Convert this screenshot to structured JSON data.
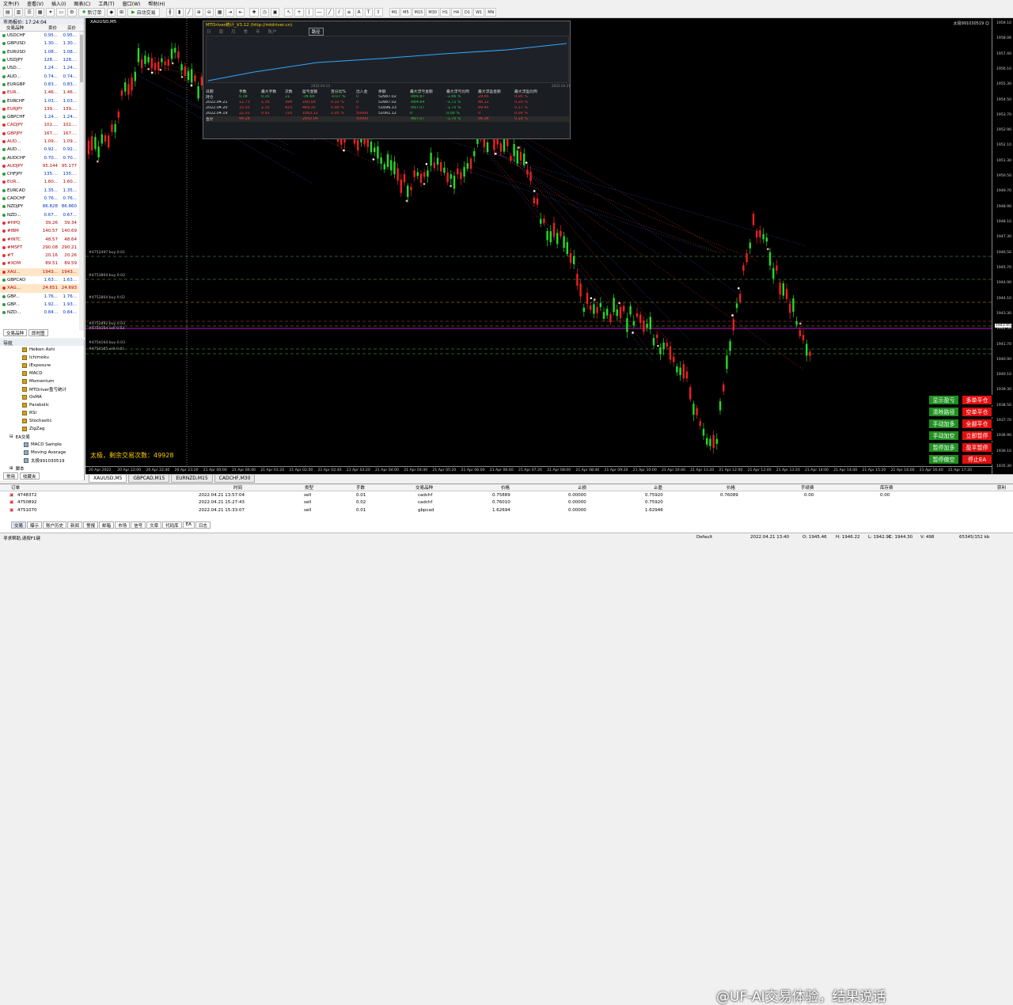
{
  "menu": [
    "文件(F)",
    "查看(V)",
    "插入(I)",
    "图表(C)",
    "工具(T)",
    "窗口(W)",
    "帮助(H)"
  ],
  "toolbar": {
    "new_order": "新订单",
    "auto_trading": "自动交易",
    "timeframes": [
      "M1",
      "M5",
      "M15",
      "M30",
      "H1",
      "H4",
      "D1",
      "W1",
      "MN"
    ]
  },
  "market_watch": {
    "title": "市场报价: 17:24:04",
    "col_symbol": "交易品种",
    "col_bid": "卖价",
    "col_ask": "买价",
    "rows": [
      {
        "sym": "USDCHF",
        "bid": "0.95...",
        "ask": "0.95...",
        "dir": "u"
      },
      {
        "sym": "GBPUSD",
        "bid": "1.30...",
        "ask": "1.30...",
        "dir": "u"
      },
      {
        "sym": "EURUSD",
        "bid": "1.08...",
        "ask": "1.08...",
        "dir": "u"
      },
      {
        "sym": "USDJPY",
        "bid": "128....",
        "ask": "128....",
        "dir": "u"
      },
      {
        "sym": "USD...",
        "bid": "1.24...",
        "ask": "1.24...",
        "dir": "u"
      },
      {
        "sym": "AUD...",
        "bid": "0.74...",
        "ask": "0.74...",
        "dir": "u"
      },
      {
        "sym": "EURGBP",
        "bid": "0.83...",
        "ask": "0.83...",
        "dir": "u"
      },
      {
        "sym": "EUR...",
        "bid": "1.46...",
        "ask": "1.46...",
        "dir": "s"
      },
      {
        "sym": "EURCHF",
        "bid": "1.03...",
        "ask": "1.03...",
        "dir": "u"
      },
      {
        "sym": "EURJPY",
        "bid": "139....",
        "ask": "139....",
        "dir": "s"
      },
      {
        "sym": "GBPCHF",
        "bid": "1.24...",
        "ask": "1.24...",
        "dir": "u"
      },
      {
        "sym": "CADJPY",
        "bid": "102....",
        "ask": "102....",
        "dir": "s"
      },
      {
        "sym": "GBPJPY",
        "bid": "167....",
        "ask": "167....",
        "dir": "s"
      },
      {
        "sym": "AUD...",
        "bid": "1.09...",
        "ask": "1.09...",
        "dir": "s"
      },
      {
        "sym": "AUD...",
        "bid": "0.92...",
        "ask": "0.92...",
        "dir": "u"
      },
      {
        "sym": "AUDCHF",
        "bid": "0.70...",
        "ask": "0.70...",
        "dir": "u"
      },
      {
        "sym": "AUDJPY",
        "bid": "95.144",
        "ask": "95.177",
        "dir": "s"
      },
      {
        "sym": "CHFJPY",
        "bid": "135....",
        "ask": "135....",
        "dir": "u"
      },
      {
        "sym": "EUR...",
        "bid": "1.60...",
        "ask": "1.60...",
        "dir": "s"
      },
      {
        "sym": "EURCAD",
        "bid": "1.35...",
        "ask": "1.35...",
        "dir": "u"
      },
      {
        "sym": "CADCHF",
        "bid": "0.76...",
        "ask": "0.76...",
        "dir": "u"
      },
      {
        "sym": "NZDJPY",
        "bid": "86.828",
        "ask": "86.860",
        "dir": "u"
      },
      {
        "sym": "NZD...",
        "bid": "0.67...",
        "ask": "0.67...",
        "dir": "u"
      },
      {
        "sym": "#HPQ",
        "bid": "39.26",
        "ask": "39.34",
        "dir": "s"
      },
      {
        "sym": "#IBM",
        "bid": "140.57",
        "ask": "140.69",
        "dir": "s"
      },
      {
        "sym": "#INTC",
        "bid": "48.57",
        "ask": "48.64",
        "dir": "s"
      },
      {
        "sym": "#MSFT",
        "bid": "290.08",
        "ask": "290.21",
        "dir": "s"
      },
      {
        "sym": "#T",
        "bid": "20.16",
        "ask": "20.26",
        "dir": "s"
      },
      {
        "sym": "#XOM",
        "bid": "89.51",
        "ask": "89.59",
        "dir": "s"
      },
      {
        "sym": "XAU...",
        "bid": "1943...",
        "ask": "1943...",
        "dir": "s",
        "hl": true
      },
      {
        "sym": "GBPCAD",
        "bid": "1.63...",
        "ask": "1.63...",
        "dir": "u"
      },
      {
        "sym": "XAG...",
        "bid": "24.651",
        "ask": "24.693",
        "dir": "s",
        "hl": true
      },
      {
        "sym": "GBP...",
        "bid": "1.76...",
        "ask": "1.76...",
        "dir": "u"
      },
      {
        "sym": "GBP...",
        "bid": "1.92...",
        "ask": "1.93...",
        "dir": "u"
      },
      {
        "sym": "NZD...",
        "bid": "0.84...",
        "ask": "0.84...",
        "dir": "u"
      }
    ],
    "tabs": [
      "交易品种",
      "即时图"
    ]
  },
  "navigator": {
    "title": "导航",
    "indicators": [
      "Heiken Ashi",
      "Ichimoku",
      "iExposure",
      "MACD",
      "Momentum",
      "MTDriver盈亏统计",
      "OsMA",
      "Parabolic",
      "RSI",
      "Stochastic",
      "ZigZag"
    ],
    "ea_group": "EA交易",
    "eas": [
      "MACD Sample",
      "Moving Average",
      "太极991030519"
    ],
    "scripts_group": "脚本",
    "tabs": [
      "常用",
      "收藏夹"
    ]
  },
  "chart": {
    "symbol_title": "XAUUSD,M5",
    "top_right": "太极991030519 ☺",
    "status_text": "太极，剩余交易次数：49928",
    "price_ticks": [
      "1959.10",
      "1958.06",
      "1957.40",
      "1956.10",
      "1955.30",
      "1954.50",
      "1953.70",
      "1952.90",
      "1952.10",
      "1951.30",
      "1950.50",
      "1949.70",
      "1948.90",
      "1948.10",
      "1947.30",
      "1946.50",
      "1945.70",
      "1944.90",
      "1944.10",
      "1943.30",
      "1942.50",
      "1941.70",
      "1940.90",
      "1940.10",
      "1939.30",
      "1938.50",
      "1937.70",
      "1936.90",
      "1936.10",
      "1935.30"
    ],
    "current_price": "1943.95",
    "time_ticks": [
      "20 Apr 2022",
      "20 Apr 22:00",
      "20 Apr 22:40",
      "20 Apr 23:20",
      "21 Apr 00:00",
      "21 Apr 00:40",
      "21 Apr 01:20",
      "21 Apr 02:00",
      "21 Apr 02:40",
      "21 Apr 03:20",
      "21 Apr 04:00",
      "21 Apr 04:40",
      "21 Apr 05:20",
      "21 Apr 06:00",
      "21 Apr 06:40",
      "21 Apr 07:20",
      "21 Apr 08:00",
      "21 Apr 08:40",
      "21 Apr 09:20",
      "21 Apr 10:00",
      "21 Apr 10:40",
      "21 Apr 11:20",
      "21 Apr 12:00",
      "21 Apr 12:40",
      "21 Apr 13:20",
      "21 Apr 14:00",
      "21 Apr 14:40",
      "21 Apr 15:20",
      "21 Apr 16:00",
      "21 Apr 16:40",
      "21 Apr 17:20"
    ],
    "levels": [
      "#4752497 buy 0.01",
      "#4753804 buy 0.02",
      "#4752864 buy 0.02",
      "#4752892 buy 0.03",
      "#4754164 sell 0.03",
      "#4754164 buy 0.03",
      "#4754165 sell 0.01"
    ]
  },
  "stats_panel": {
    "title": "MTDriver统计_V3.12 (http://mtdriver.cn)",
    "menu": [
      "日",
      "周",
      "月",
      "季",
      "年",
      "账户",
      "路径"
    ],
    "date_left": "2022.04.13",
    "date_right": "2022.04.21",
    "headers": [
      "日期",
      "手数",
      "最大手数",
      "次数",
      "盈亏金额",
      "百分比%",
      "出入金",
      "余额",
      "最大浮亏金额",
      "最大浮亏比例",
      "最大浮盈金额",
      "最大浮盈比例"
    ],
    "rows": [
      [
        "持仓",
        "0.38",
        "0.03",
        "21",
        "-34.68",
        "-0.07 %",
        "0",
        "52687.02",
        "-884.87",
        "-1.66 %",
        "29.65",
        "0.05 %"
      ],
      [
        "2022.04.21",
        "11.73",
        "1.35",
        "394",
        "160.58",
        "0.32 %",
        "0",
        "52687.02",
        "-884.64",
        "-1.71 %",
        "88.11",
        "0.20 %"
      ],
      [
        "2022.04.20",
        "15.03",
        "1.35",
        "433",
        "469.35",
        "0.90 %",
        "0",
        "51696.33",
        "-897.07",
        "-1.75 %",
        "69.45",
        "0.17 %"
      ],
      [
        "2022.04.19",
        "22.01",
        "0.91",
        "720",
        "1063.12",
        "2.05 %",
        "50000",
        "51061.12",
        "0",
        "0.00 %",
        "0",
        "0.00 %"
      ],
      [
        "合计",
        "44.28",
        "",
        "",
        "2692.04",
        "",
        "50000",
        "",
        "-897.07",
        "-1.75 %",
        "98.08",
        "0.19 %"
      ]
    ]
  },
  "control_buttons": [
    {
      "label": "显示盈亏",
      "color": "g"
    },
    {
      "label": "多单平仓",
      "color": "r"
    },
    {
      "label": "清除路径",
      "color": "g"
    },
    {
      "label": "空单平仓",
      "color": "r"
    },
    {
      "label": "手动加多",
      "color": "g"
    },
    {
      "label": "全部平仓",
      "color": "r"
    },
    {
      "label": "手动加空",
      "color": "g"
    },
    {
      "label": "立即暂停",
      "color": "r"
    },
    {
      "label": "暂停加多",
      "color": "g"
    },
    {
      "label": "盈平暂停",
      "color": "r"
    },
    {
      "label": "暂停做空",
      "color": "g"
    },
    {
      "label": "停止EA",
      "color": "r"
    }
  ],
  "chart_tabs": [
    "XAUUSD,M5",
    "GBPCAD,M15",
    "EURNZD,M15",
    "CADCHF,M30"
  ],
  "terminal": {
    "headers": [
      "订单",
      "时间",
      "类型",
      "手数",
      "交易品种",
      "价格",
      "止损",
      "止盈",
      "价格",
      "手续费",
      "库存费",
      "获利"
    ],
    "rows": [
      [
        "4748372",
        "2022.04.21 13:57:04",
        "sell",
        "0.01",
        "cadchf",
        "0.75889",
        "0.00000",
        "0.75920",
        "0.76089",
        "0.00",
        "0.00",
        ""
      ],
      [
        "4750892",
        "2022.04.21 15:27:43",
        "sell",
        "0.02",
        "cadchf",
        "0.76010",
        "0.00000",
        "0.75920",
        "",
        "",
        "",
        ""
      ],
      [
        "4751070",
        "2022.04.21 15:33:07",
        "sell",
        "0.01",
        "gbpcad",
        "1.62694",
        "0.00000",
        "1.62946",
        "",
        "",
        "",
        ""
      ]
    ],
    "tabs": [
      "交易",
      "曝示",
      "账户历史",
      "新闻",
      "警报",
      "邮箱",
      "市场",
      "信号",
      "文章",
      "代码库",
      "EA",
      "日志"
    ]
  },
  "watermark": "@UF-AI交易体验，结果说话",
  "status_bar": {
    "help": "寻求帮助,请按F1键",
    "profile": "Default",
    "datetime": "2022.04.21 13:40",
    "open": "O: 1945.46",
    "high": "H: 1946.22",
    "low": "L: 1942.91",
    "close": "C: 1944.30",
    "volume": "V: 498",
    "traffic": "65345/152 kb"
  }
}
